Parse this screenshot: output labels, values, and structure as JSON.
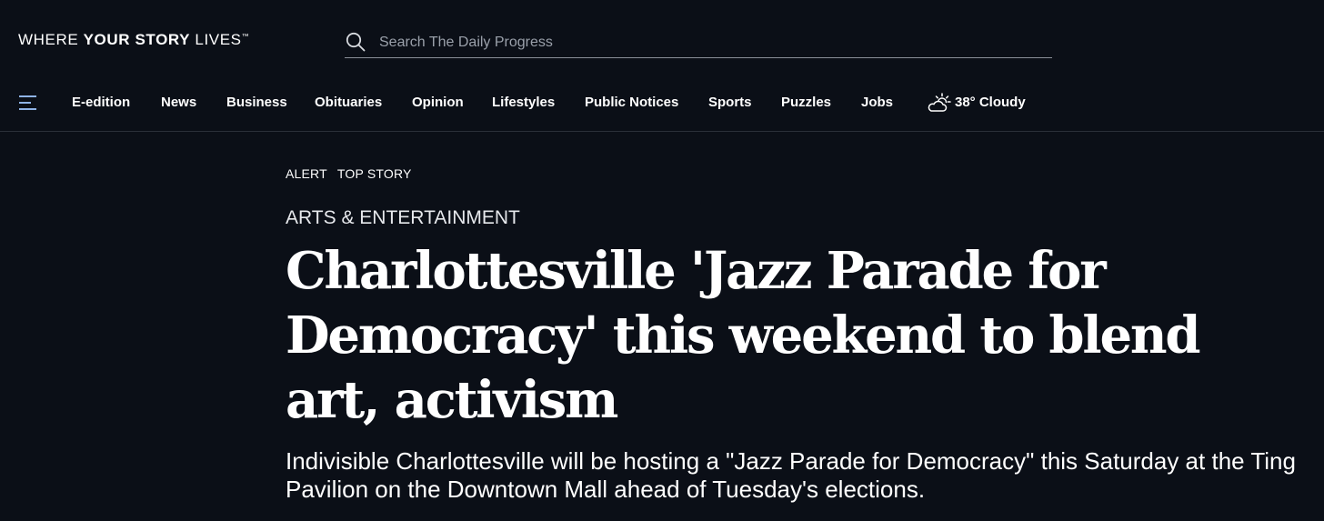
{
  "header": {
    "tagline_part1": "WHERE ",
    "tagline_bold": "YOUR STORY",
    "tagline_part2": " LIVES",
    "tagline_tm": "™",
    "search_placeholder": "Search The Daily Progress",
    "search_value": ""
  },
  "nav": {
    "items": [
      {
        "label": "E-edition"
      },
      {
        "label": "News"
      },
      {
        "label": "Business"
      },
      {
        "label": "Obituaries"
      },
      {
        "label": "Opinion"
      },
      {
        "label": "Lifestyles"
      },
      {
        "label": "Public Notices"
      },
      {
        "label": "Sports"
      },
      {
        "label": "Puzzles"
      },
      {
        "label": "Jobs"
      }
    ],
    "weather": {
      "icon": "partly-cloudy-icon",
      "text": "38° Cloudy"
    },
    "menu_icon": "hamburger-menu-icon"
  },
  "article": {
    "labels": [
      "ALERT",
      "TOP STORY"
    ],
    "section": "ARTS & ENTERTAINMENT",
    "headline": "Charlottesville 'Jazz Parade for Democracy' this weekend to blend art, activism",
    "summary": "Indivisible Charlottesville will be hosting a \"Jazz Parade for Democracy\" this Saturday at the Ting Pavilion on the Downtown Mall ahead of Tuesday's elections."
  },
  "colors": {
    "background": "#0b0f17",
    "text": "#ffffff",
    "menu_icon": "#8fb3e6"
  }
}
